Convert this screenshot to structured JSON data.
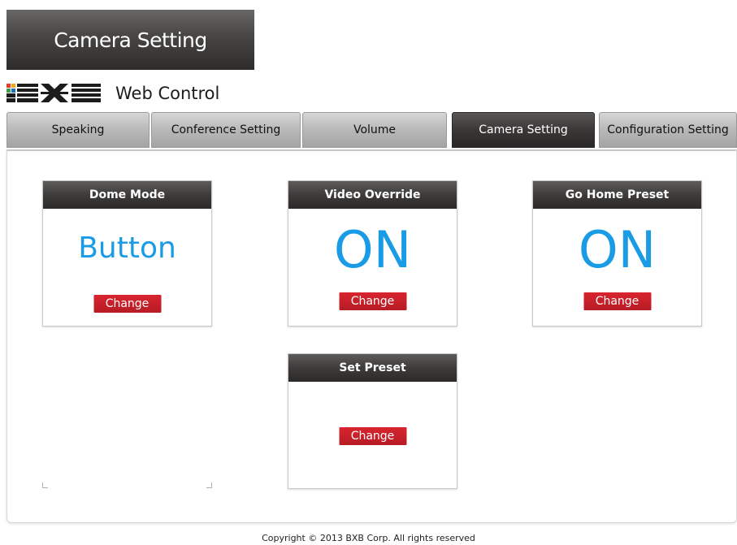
{
  "banner": {
    "title": "Camera Setting"
  },
  "brand": {
    "logo_text": "BXB",
    "app_title": "Web Control"
  },
  "tabs": [
    {
      "label": "Speaking"
    },
    {
      "label": "Conference Setting"
    },
    {
      "label": "Volume"
    },
    {
      "label": "Camera Setting",
      "active": true
    },
    {
      "label": "Configuration Setting"
    }
  ],
  "panels": {
    "dome_mode": {
      "title": "Dome Mode",
      "value": "Button",
      "button": "Change"
    },
    "video_override": {
      "title": "Video Override",
      "value": "ON",
      "button": "Change"
    },
    "go_home_preset": {
      "title": "Go Home Preset",
      "value": "ON",
      "button": "Change"
    },
    "set_preset": {
      "title": "Set Preset",
      "button": "Change"
    }
  },
  "footer": {
    "copyright": "Copyright © 2013 BXB Corp. All rights reserved"
  },
  "colors": {
    "accent_value": "#1a9be6",
    "button_red": "#c41f28",
    "header_dark": "#3a3837"
  }
}
